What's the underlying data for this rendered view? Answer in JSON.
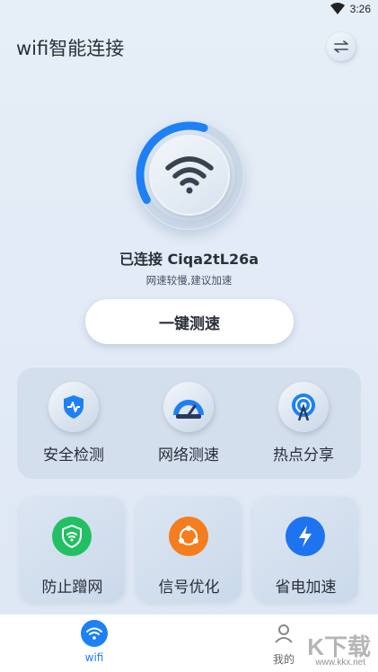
{
  "status_bar": {
    "time": "3:26",
    "icon": "wifi-signal-icon"
  },
  "header": {
    "title": "wifi智能连接",
    "switch_icon": "swap-arrows-icon"
  },
  "connection": {
    "status_text": "已连接 Ciqa2tL26a",
    "hint": "网速较慢,建议加速",
    "signal_progress_percent": 38
  },
  "speed_test_button": {
    "label": "一键测速"
  },
  "tools": [
    {
      "label": "安全检测",
      "icon": "shield-pulse-icon"
    },
    {
      "label": "网络测速",
      "icon": "speedometer-icon"
    },
    {
      "label": "热点分享",
      "icon": "hotspot-icon"
    }
  ],
  "features": [
    {
      "label": "防止蹭网",
      "icon": "shield-wifi-icon",
      "color": "#22c064"
    },
    {
      "label": "信号优化",
      "icon": "share-nodes-icon",
      "color": "#f57d1e"
    },
    {
      "label": "省电加速",
      "icon": "lightning-icon",
      "color": "#1e73f0"
    }
  ],
  "bottom_nav": {
    "items": [
      {
        "label": "wifi",
        "icon": "wifi-icon",
        "active": true
      },
      {
        "label": "我的",
        "icon": "user-icon",
        "active": false
      }
    ]
  },
  "watermark": {
    "text": "K下载",
    "sub": "www.kkx.net"
  },
  "colors": {
    "accent_blue": "#1e73f0",
    "primary_text": "#2a2f3a"
  }
}
